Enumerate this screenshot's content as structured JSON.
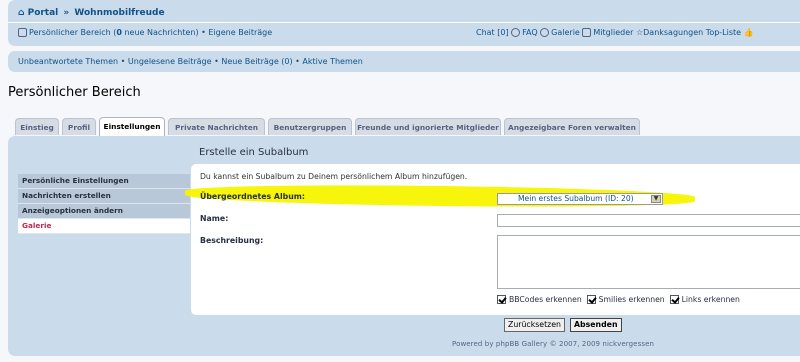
{
  "breadcrumb": {
    "home": "Portal",
    "separator": "»",
    "forum": "Wohnmobilfreude"
  },
  "userbar": {
    "ucp_prefix": "Persönlicher Bereich (",
    "ucp_count": "0",
    "ucp_suffix": " neue Nachrichten)",
    "dot": "•",
    "own_posts": "Eigene Beiträge",
    "chat": "Chat [0]",
    "faq": "FAQ",
    "gallery": "Galerie",
    "members": "Mitglieder",
    "thanks": "Danksagungen Top-Liste"
  },
  "quicklinks": {
    "text": "Unbeantwortete Themen • Ungelesene Beiträge • Neue Beiträge (0) • Aktive Themen"
  },
  "page_title": "Persönlicher Bereich",
  "tabs": [
    "Einstieg",
    "Profil",
    "Einstellungen",
    "Private Nachrichten",
    "Benutzergruppen",
    "Freunde und ignorierte Mitglieder",
    "Angezeigbare Foren verwalten"
  ],
  "active_tab": "Einstellungen",
  "menu": {
    "items": [
      "Persönliche Einstellungen",
      "Nachrichten erstellen",
      "Anzeigeoptionen ändern",
      "Galerie"
    ],
    "active": "Galerie"
  },
  "form": {
    "title": "Erstelle ein Subalbum",
    "intro": "Du kannst ein Subalbum zu Deinem persönlichem Album hinzufügen.",
    "parent_label": "Übergeordnetes Album:",
    "parent_value": "Mein erstes Subalbum (ID: 20)",
    "name_label": "Name:",
    "name_value": "",
    "desc_label": "Beschreibung:",
    "desc_value": "",
    "options": [
      {
        "label": "BBCodes erkennen",
        "checked": true
      },
      {
        "label": "Smilies erkennen",
        "checked": true
      },
      {
        "label": "Links erkennen",
        "checked": true
      }
    ],
    "reset_label": "Zurücksetzen",
    "submit_label": "Absenden"
  },
  "footer": "Powered by phpBB Gallery © 2007, 2009 nickvergessen",
  "colors": {
    "highlight": "#f8f400",
    "panel": "#cadceb",
    "active_menu_text": "#bc2a4d",
    "link": "#105289"
  }
}
